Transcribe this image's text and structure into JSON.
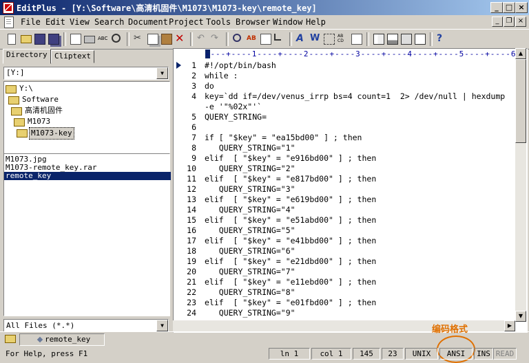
{
  "window": {
    "title": "EditPlus - [Y:\\Software\\高清机固件\\M1073\\M1073-key\\remote_key]",
    "controls": [
      "_",
      "□",
      "×"
    ]
  },
  "menu": [
    "File",
    "Edit",
    "View",
    "Search",
    "Document",
    "Project",
    "Tools",
    "Browser",
    "Window",
    "Help"
  ],
  "toolbar_icons": [
    "new-icon",
    "open-icon",
    "save-icon",
    "save-all-icon",
    "print-preview-icon",
    "print-icon",
    "spell-check-icon",
    "find-icon",
    "cut-icon",
    "copy-icon",
    "paste-icon",
    "delete-icon",
    "undo-icon",
    "redo-icon",
    "find-in-files-icon",
    "replace-icon",
    "go-to-icon",
    "insert-icon",
    "font-icon",
    "word-wrap-icon",
    "column-select-icon",
    "hex-icon",
    "settings-icon",
    "directory-window-icon",
    "output-window-icon",
    "user-tool-icon",
    "browser-icon",
    "help-icon"
  ],
  "left_panel": {
    "tabs": [
      "Directory",
      "Cliptext"
    ],
    "drive": "[Y:]",
    "tree": [
      "Y:\\",
      "Software",
      "高清机固件",
      "M1073",
      "M1073-key"
    ],
    "files": [
      "M1073.jpg",
      "M1073-remote_key.rar",
      "remote_key"
    ],
    "filter": "All Files (*.*)"
  },
  "editor": {
    "ruler": "----+----1----+----2----+----3----+----4----+----5----+----6----",
    "lines": [
      {
        "n": "1",
        "t": "#!/opt/bin/bash"
      },
      {
        "n": "2",
        "t": "while :"
      },
      {
        "n": "3",
        "t": "do"
      },
      {
        "n": "4",
        "t": "key=`dd if=/dev/venus_irrp bs=4 count=1  2> /dev/null | hexdump"
      },
      {
        "n": "",
        "t": "-e '\"%02x\"'`"
      },
      {
        "n": "5",
        "t": "QUERY_STRING="
      },
      {
        "n": "6",
        "t": ""
      },
      {
        "n": "7",
        "t": "if [ \"$key\" = \"ea15bd00\" ] ; then"
      },
      {
        "n": "8",
        "t": "   QUERY_STRING=\"1\""
      },
      {
        "n": "9",
        "t": "elif  [ \"$key\" = \"e916bd00\" ] ; then"
      },
      {
        "n": "10",
        "t": "   QUERY_STRING=\"2\""
      },
      {
        "n": "11",
        "t": "elif  [ \"$key\" = \"e817bd00\" ] ; then"
      },
      {
        "n": "12",
        "t": "   QUERY_STRING=\"3\""
      },
      {
        "n": "13",
        "t": "elif  [ \"$key\" = \"e619bd00\" ] ; then"
      },
      {
        "n": "14",
        "t": "   QUERY_STRING=\"4\""
      },
      {
        "n": "15",
        "t": "elif  [ \"$key\" = \"e51abd00\" ] ; then"
      },
      {
        "n": "16",
        "t": "   QUERY_STRING=\"5\""
      },
      {
        "n": "17",
        "t": "elif  [ \"$key\" = \"e41bbd00\" ] ; then"
      },
      {
        "n": "18",
        "t": "   QUERY_STRING=\"6\""
      },
      {
        "n": "19",
        "t": "elif  [ \"$key\" = \"e21dbd00\" ] ; then"
      },
      {
        "n": "20",
        "t": "   QUERY_STRING=\"7\""
      },
      {
        "n": "21",
        "t": "elif  [ \"$key\" = \"e11ebd00\" ] ; then"
      },
      {
        "n": "22",
        "t": "   QUERY_STRING=\"8\""
      },
      {
        "n": "23",
        "t": "elif  [ \"$key\" = \"e01fbd00\" ] ; then"
      },
      {
        "n": "24",
        "t": "   QUERY_STRING=\"9\""
      }
    ]
  },
  "doc_tab": "remote_key",
  "annotation": "编码格式",
  "status": {
    "help": "For Help, press F1",
    "ln": "ln 1",
    "col": "col 1",
    "total": "145",
    "num": "23",
    "format": "UNIX",
    "encoding": "ANSI",
    "ins": "INS",
    "read": "READ"
  },
  "colors": {
    "title_start": "#0a246a",
    "title_end": "#a6caf0",
    "selection": "#0a246a",
    "annotation": "#e07000"
  }
}
